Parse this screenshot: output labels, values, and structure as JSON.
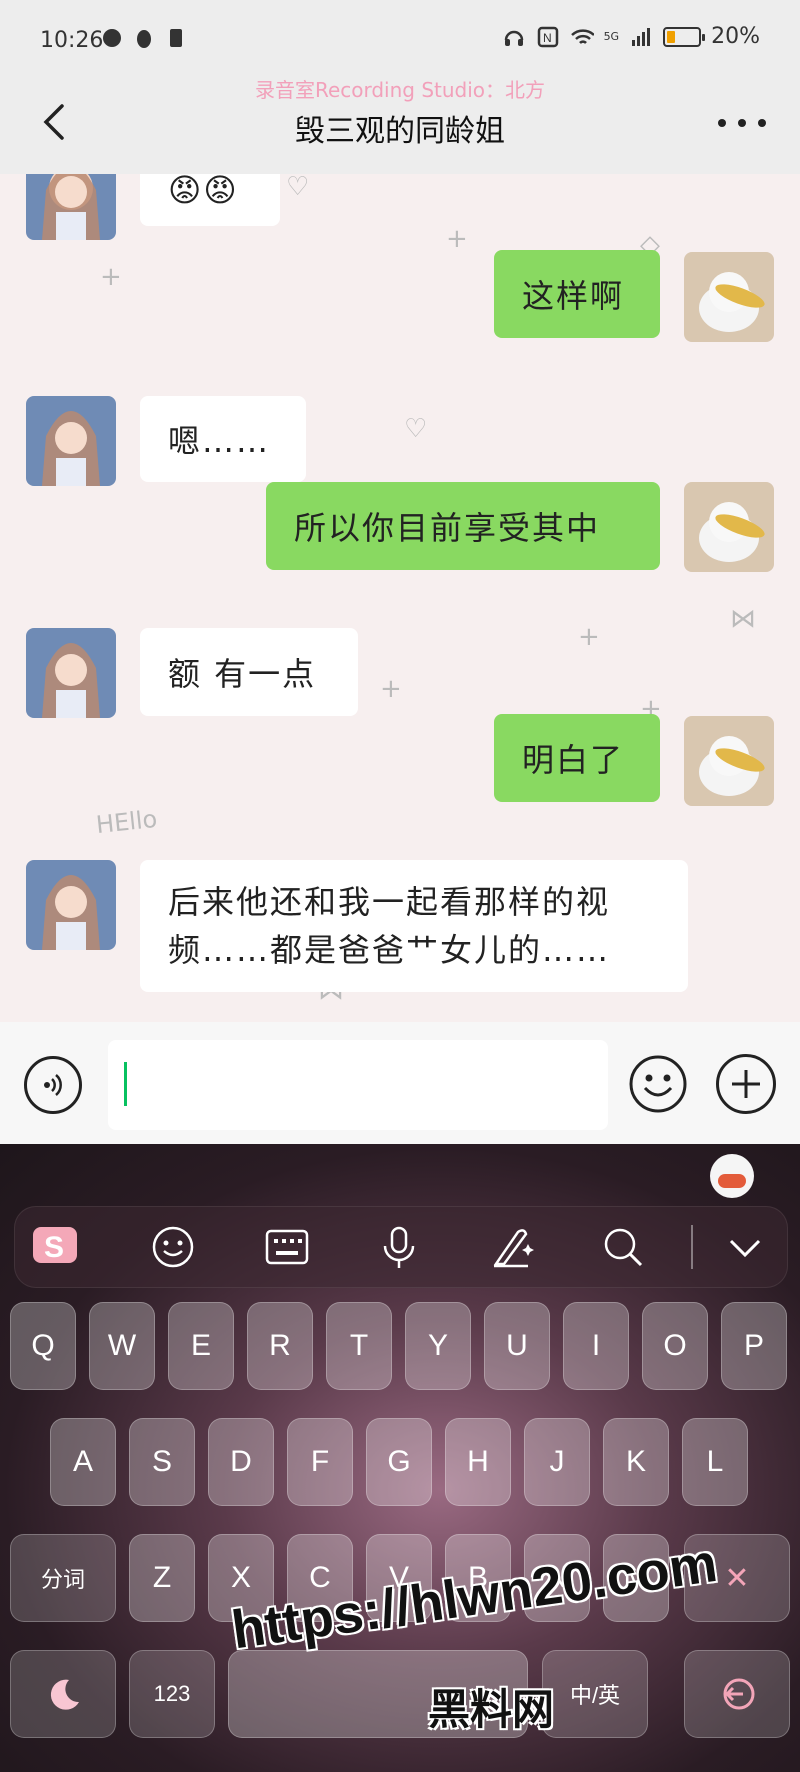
{
  "status_bar": {
    "time": "10:26",
    "battery_percent": "20%",
    "network": "5G",
    "icons": [
      "globe-icon",
      "qq-icon",
      "sim-icon",
      "headphones-icon",
      "nfc-icon",
      "wifi-icon",
      "signal-icon",
      "battery-icon"
    ]
  },
  "header": {
    "recording_label": "录音室Recording Studio：北方",
    "title": "毁三观的同龄姐",
    "icons": [
      "back-icon",
      "more-icon"
    ]
  },
  "messages": [
    {
      "side": "left",
      "text": "😡😡"
    },
    {
      "side": "right",
      "text": "这样啊"
    },
    {
      "side": "left",
      "text": "嗯……"
    },
    {
      "side": "right",
      "text": "所以你目前享受其中"
    },
    {
      "side": "left",
      "text": "额 有一点"
    },
    {
      "side": "right",
      "text": "明白了"
    },
    {
      "side": "left",
      "text": "后来他还和我一起看那样的视频……都是爸爸艹女儿的……"
    }
  ],
  "decorations": {
    "hello_text": "HEllo"
  },
  "input_bar": {
    "placeholder": "",
    "icons": [
      "voice-icon",
      "emoji-icon",
      "plus-icon"
    ]
  },
  "keyboard": {
    "toolbar_icons": [
      "sogou-logo-icon",
      "emoji-icon",
      "keyboard-icon",
      "mic-icon",
      "handwriting-icon",
      "search-icon",
      "chevron-down-icon"
    ],
    "row1": [
      "Q",
      "W",
      "E",
      "R",
      "T",
      "Y",
      "U",
      "I",
      "O",
      "P"
    ],
    "row2": [
      "A",
      "S",
      "D",
      "F",
      "G",
      "H",
      "J",
      "K",
      "L"
    ],
    "row3": [
      "分词",
      "Z",
      "X",
      "C",
      "V",
      "B",
      "N",
      "M"
    ],
    "delete_symbol": "✕",
    "bottom": {
      "num_key": "123",
      "lang_key": "中/英"
    }
  },
  "watermark": {
    "url": "https://hlwn20.com",
    "name": "黑料网"
  }
}
